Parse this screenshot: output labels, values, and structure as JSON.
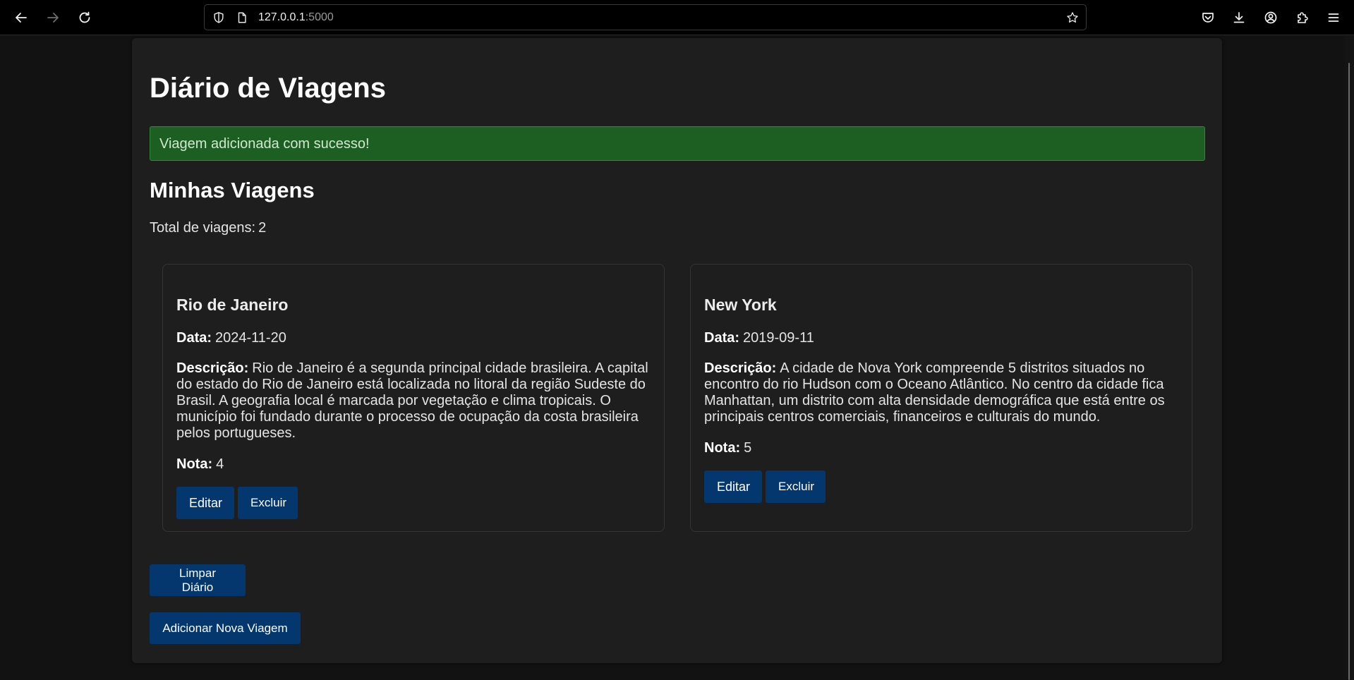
{
  "browser": {
    "url_host": "127.0.0.1",
    "url_port": ":5000"
  },
  "page": {
    "title": "Diário de Viagens",
    "flash_message": "Viagem adicionada com sucesso!",
    "section_title": "Minhas Viagens",
    "total_label": "Total de viagens:",
    "total_count": "2"
  },
  "labels": {
    "date": "Data:",
    "description": "Descrição:",
    "rating": "Nota:",
    "edit": "Editar",
    "delete": "Excluir"
  },
  "trips": [
    {
      "name": "Rio de Janeiro",
      "date": "2024-11-20",
      "description": "Rio de Janeiro é a segunda principal cidade brasileira. A capital do estado do Rio de Janeiro está localizada no litoral da região Sudeste do Brasil. A geografia local é marcada por vegetação e clima tropicais. O município foi fundado durante o processo de ocupação da costa brasileira pelos portugueses.",
      "rating": "4"
    },
    {
      "name": "New York",
      "date": "2019-09-11",
      "description": "A cidade de Nova York compreende 5 distritos situados no encontro do rio Hudson com o Oceano Atlântico. No centro da cidade fica Manhattan, um distrito com alta densidade demográfica que está entre os principais centros comerciais, financeiros e culturais do mundo.",
      "rating": "5"
    }
  ],
  "actions": {
    "clear_label": "Limpar Diário",
    "add_label": "Adicionar Nova Viagem"
  },
  "icons": {
    "back": "back-arrow-icon",
    "forward": "forward-arrow-icon",
    "reload": "reload-icon",
    "shield": "shield-icon",
    "page": "page-icon",
    "bookmark": "star-icon",
    "pocket": "pocket-icon",
    "downloads": "download-icon",
    "account": "account-icon",
    "extensions": "puzzle-icon",
    "menu": "hamburger-menu-icon"
  },
  "colors": {
    "accent_button": "#04376e",
    "flash_background": "#1d5e22"
  }
}
